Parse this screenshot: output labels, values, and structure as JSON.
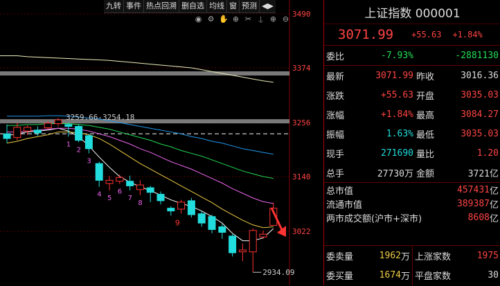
{
  "toolbar": [
    "九转",
    "事件",
    "热点回溯",
    "删自选",
    "均线",
    "窗",
    "预测",
    "◀▶"
  ],
  "icons": [
    {
      "name": "eye-icon",
      "glyph": "◉"
    },
    {
      "name": "gear-icon",
      "glyph": "⚙"
    },
    {
      "name": "hand-icon",
      "glyph": "✋"
    },
    {
      "name": "zoom-in-icon",
      "glyph": "⊕"
    },
    {
      "name": "cut-icon",
      "glyph": "✂"
    },
    {
      "name": "pin-icon",
      "glyph": "⍊"
    },
    {
      "name": "plus-icon",
      "glyph": "⊕"
    },
    {
      "name": "minus-icon",
      "glyph": "⊖"
    }
  ],
  "title": "上证指数 000001",
  "price": "3071.99",
  "change": "+55.63",
  "pct": "+1.84%",
  "stats": [
    {
      "l": "委比",
      "v": "-7.93%",
      "vc": "grn",
      "l2": "",
      "v2": "-2881130",
      "v2c": "grn"
    },
    {
      "l": "最新",
      "v": "3071.99",
      "vc": "red",
      "l2": "昨收",
      "v2": "3016.36",
      "v2c": ""
    },
    {
      "l": "涨跌",
      "v": "+55.63",
      "vc": "red",
      "l2": "开盘",
      "v2": "3035.03",
      "v2c": "red"
    },
    {
      "l": "涨幅",
      "v": "+1.84%",
      "vc": "red",
      "l2": "最高",
      "v2": "3084.27",
      "v2c": "red"
    },
    {
      "l": "振幅",
      "v": "1.63%",
      "vc": "cyan",
      "l2": "最低",
      "v2": "3035.03",
      "v2c": "red"
    },
    {
      "l": "现手",
      "v": "271690",
      "vc": "cyan",
      "l2": "量比",
      "v2": "1.20",
      "v2c": "red"
    },
    {
      "l": "总手",
      "v": "27730万",
      "vc": "",
      "l2": "金额",
      "v2": "3721亿",
      "v2c": ""
    }
  ],
  "caps": [
    {
      "l": "总市值",
      "v": "457431",
      "u": "亿"
    },
    {
      "l": "流通市值",
      "v": "389387",
      "u": "亿"
    },
    {
      "l": "两市成交额(沪市+深市)",
      "v": "8608",
      "u": "亿"
    }
  ],
  "bottom": {
    "col1": [
      {
        "l": "委卖量",
        "v": "1962",
        "u": "万"
      },
      {
        "l": "委买量",
        "v": "1674",
        "u": "万"
      }
    ],
    "col2": [
      {
        "l": "上涨家数",
        "v": "1975"
      },
      {
        "l": "平盘家数",
        "v": "30"
      }
    ]
  },
  "chart_data": {
    "type": "candlestick",
    "y_ticks": [
      3490,
      3374,
      3256,
      3140,
      3022
    ],
    "ylim": [
      2906,
      3520
    ],
    "annotations": [
      {
        "text": "3259.66-3254.18"
      },
      {
        "text": "2934.09"
      }
    ],
    "nine_turn_labels": [
      "1",
      "2",
      "3",
      "4",
      "5",
      "6",
      "7",
      "8",
      "9"
    ],
    "candles": [
      {
        "o": 3232,
        "c": 3222,
        "h": 3252,
        "l": 3212
      },
      {
        "o": 3224,
        "c": 3246,
        "h": 3256,
        "l": 3218
      },
      {
        "o": 3238,
        "c": 3246,
        "h": 3250,
        "l": 3230
      },
      {
        "o": 3240,
        "c": 3234,
        "h": 3248,
        "l": 3228
      },
      {
        "o": 3245,
        "c": 3255,
        "h": 3259,
        "l": 3241
      },
      {
        "o": 3254,
        "c": 3262,
        "h": 3266,
        "l": 3248
      },
      {
        "o": 3252,
        "c": 3248,
        "h": 3256,
        "l": 3226
      },
      {
        "o": 3248,
        "c": 3218,
        "h": 3253,
        "l": 3214
      },
      {
        "o": 3228,
        "c": 3200,
        "h": 3232,
        "l": 3190
      },
      {
        "o": 3168,
        "c": 3132,
        "h": 3172,
        "l": 3118
      },
      {
        "o": 3125,
        "c": 3132,
        "h": 3141,
        "l": 3110
      },
      {
        "o": 3130,
        "c": 3138,
        "h": 3144,
        "l": 3124
      },
      {
        "o": 3130,
        "c": 3120,
        "h": 3142,
        "l": 3110
      },
      {
        "o": 3112,
        "c": 3122,
        "h": 3132,
        "l": 3100
      },
      {
        "o": 3116,
        "c": 3106,
        "h": 3120,
        "l": 3085
      },
      {
        "o": 3102,
        "c": 3088,
        "h": 3108,
        "l": 3080
      },
      {
        "o": 3072,
        "c": 3066,
        "h": 3076,
        "l": 3056
      },
      {
        "o": 3070,
        "c": 3085,
        "h": 3090,
        "l": 3060
      },
      {
        "o": 3088,
        "c": 3058,
        "h": 3094,
        "l": 3052
      },
      {
        "o": 3060,
        "c": 3040,
        "h": 3066,
        "l": 3032
      },
      {
        "o": 3054,
        "c": 3026,
        "h": 3058,
        "l": 3018
      },
      {
        "o": 3032,
        "c": 3020,
        "h": 3038,
        "l": 3006
      },
      {
        "o": 3012,
        "c": 2976,
        "h": 3016,
        "l": 2968
      },
      {
        "o": 2978,
        "c": 2982,
        "h": 2996,
        "l": 2958
      },
      {
        "o": 2978,
        "c": 3024,
        "h": 3028,
        "l": 2934
      },
      {
        "o": 3010,
        "c": 3016,
        "h": 3024,
        "l": 3006
      },
      {
        "o": 3035,
        "c": 3072,
        "h": 3084,
        "l": 3035
      }
    ],
    "ma": [
      {
        "color": "#ffffff",
        "values": [
          3228,
          3232,
          3236,
          3238,
          3240,
          3244,
          3238,
          3226,
          3206,
          3182,
          3160,
          3140,
          3128,
          3118,
          3110,
          3100,
          3090,
          3082,
          3076,
          3066,
          3054,
          3040,
          3018,
          3002,
          3002,
          3008,
          3028
        ]
      },
      {
        "color": "#eecc44",
        "values": [
          3212,
          3216,
          3222,
          3226,
          3230,
          3236,
          3236,
          3234,
          3230,
          3222,
          3210,
          3196,
          3182,
          3168,
          3156,
          3144,
          3132,
          3120,
          3108,
          3096,
          3084,
          3070,
          3058,
          3046,
          3036,
          3030,
          3032
        ]
      },
      {
        "color": "#ee66ee",
        "values": [
          3236,
          3236,
          3238,
          3240,
          3242,
          3244,
          3244,
          3242,
          3238,
          3232,
          3226,
          3218,
          3210,
          3200,
          3192,
          3182,
          3172,
          3164,
          3156,
          3146,
          3136,
          3126,
          3114,
          3104,
          3094,
          3086,
          3082
        ]
      },
      {
        "color": "#22dd55",
        "values": [
          3250,
          3250,
          3252,
          3252,
          3254,
          3254,
          3254,
          3252,
          3250,
          3246,
          3242,
          3236,
          3230,
          3224,
          3218,
          3210,
          3204,
          3196,
          3190,
          3184,
          3176,
          3168,
          3160,
          3152,
          3146,
          3140,
          3136
        ]
      },
      {
        "color": "#2299ee",
        "values": [
          3270,
          3270,
          3270,
          3270,
          3271,
          3271,
          3270,
          3268,
          3266,
          3264,
          3260,
          3256,
          3252,
          3248,
          3244,
          3240,
          3236,
          3232,
          3226,
          3222,
          3216,
          3212,
          3206,
          3200,
          3196,
          3192,
          3188
        ]
      }
    ],
    "long_ma": {
      "color": "#eeeebb",
      "values": [
        3400,
        3400,
        3398,
        3397,
        3396,
        3395,
        3394,
        3393,
        3392,
        3391,
        3390,
        3388,
        3386,
        3384,
        3382,
        3380,
        3378,
        3376,
        3374,
        3370,
        3366,
        3362,
        3358,
        3354,
        3350,
        3346,
        3343
      ]
    },
    "levels": [
      {
        "value": 3362,
        "color": "#999999"
      },
      {
        "value": 3259,
        "color": "#999999"
      },
      {
        "value": 3232,
        "color": "#cccccc",
        "dashed": true
      }
    ],
    "arrow_color": "#ff3333"
  }
}
